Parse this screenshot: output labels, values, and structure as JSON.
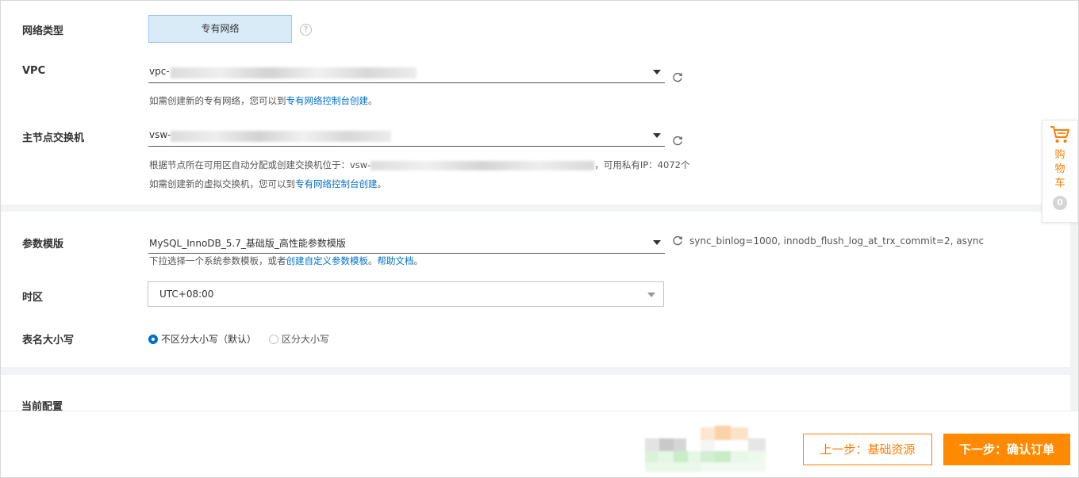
{
  "network": {
    "type_label": "网络类型",
    "type_value": "专有网络",
    "help_glyph": "?",
    "vpc_label": "VPC",
    "vpc_prefix": "vpc-",
    "vpc_hint_text": "如需创建新的专有网络，您可以到",
    "vpc_hint_link": "专有网络控制台创建",
    "vpc_hint_end": "。",
    "vswitch_label": "主节点交换机",
    "vswitch_prefix": "vsw-",
    "vswitch_info_text": "根据节点所在可用区自动分配或创建交换机位于：vsw-",
    "vswitch_info_tail": "，可用私有IP：4072个",
    "vswitch_hint_text": "如需创建新的虚拟交换机，您可以到",
    "vswitch_hint_link": "专有网络控制台创建",
    "vswitch_hint_end": "。"
  },
  "params": {
    "template_label": "参数模版",
    "template_value": "MySQL_InnoDB_5.7_基础版_高性能参数模版",
    "template_desc": "sync_binlog=1000, innodb_flush_log_at_trx_commit=2, async",
    "template_hint_text": "下拉选择一个系统参数模板，或者",
    "template_hint_link1": "创建自定义参数模板",
    "template_hint_sep": "。",
    "template_hint_link2": "帮助文档",
    "template_hint_end": "。",
    "timezone_label": "时区",
    "timezone_value": "UTC+08:00",
    "case_label": "表名大小写",
    "case_options": [
      {
        "label": "不区分大小写（默认）",
        "checked": true
      },
      {
        "label": "区分大小写",
        "checked": false
      }
    ]
  },
  "config": {
    "current_label": "当前配置"
  },
  "cart": {
    "label": "购物车",
    "count": "0"
  },
  "footer": {
    "prev_label": "上一步：基础资源",
    "next_label": "下一步：确认订单"
  },
  "colors": {
    "accent": "#ff7d00",
    "link": "#0070cc",
    "selected_bg": "#d9ebf7"
  }
}
